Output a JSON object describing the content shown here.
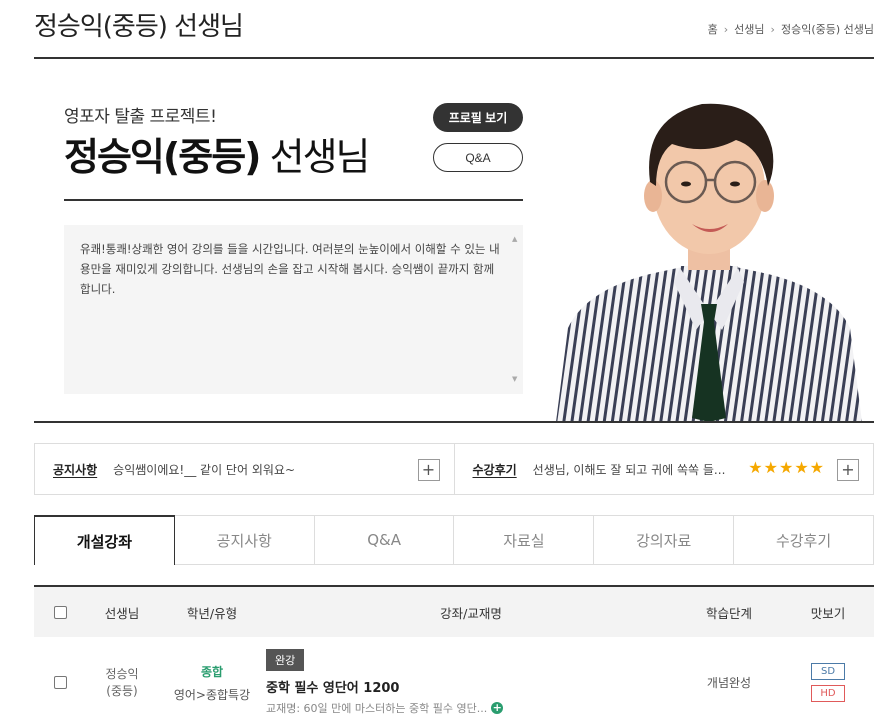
{
  "header": {
    "title": "정승익(중등) 선생님",
    "breadcrumb": [
      "홈",
      "선생님",
      "정승익(중등) 선생님"
    ]
  },
  "hero": {
    "tagline": "영포자 탈출 프로젝트!",
    "name_bold": "정승익(중등)",
    "name_rest": " 선생님",
    "profile_button": "프로필 보기",
    "qa_button": "Q&A",
    "description": "유쾌!통쾌!상쾌한 영어 강의를 들을 시간입니다. 여러분의 눈높이에서 이해할 수 있는 내용만을 재미있게 강의합니다. 선생님의 손을 잡고 시작해 봅시다. 승익쌤이 끝까지 함께 합니다."
  },
  "info_bar": {
    "notice_label": "공지사항",
    "notice_text": "승익쌤이에요!__ 같이 단어 외워요~",
    "review_label": "수강후기",
    "review_text": "선생님, 이해도 잘 되고 귀에 쏙쏙 들...",
    "stars": "★★★★★",
    "rating": 5
  },
  "tabs": [
    "개설강좌",
    "공지사항",
    "Q&A",
    "자료실",
    "강의자료",
    "수강후기"
  ],
  "table": {
    "headers": {
      "teacher": "선생님",
      "grade": "학년/유형",
      "course": "강좌/교재명",
      "level": "학습단계",
      "preview": "맛보기"
    },
    "rows": [
      {
        "teacher": "정승익\n(중등)",
        "teacher_line1": "정승익",
        "teacher_line2": "(중등)",
        "grade_type": "종합",
        "grade_sub": "영어>종합특강",
        "badge": "완강",
        "title": "중학 필수 영단어 1200",
        "sub": "교재명: 60일 만에 마스터하는 중학 필수 영단...",
        "level": "개념완성",
        "sd": "SD",
        "hd": "HD"
      }
    ]
  },
  "colors": {
    "accent_green": "#2a9d6f",
    "star": "#f5a800",
    "sd": "#4b7aa7",
    "hd": "#e05a5a"
  }
}
